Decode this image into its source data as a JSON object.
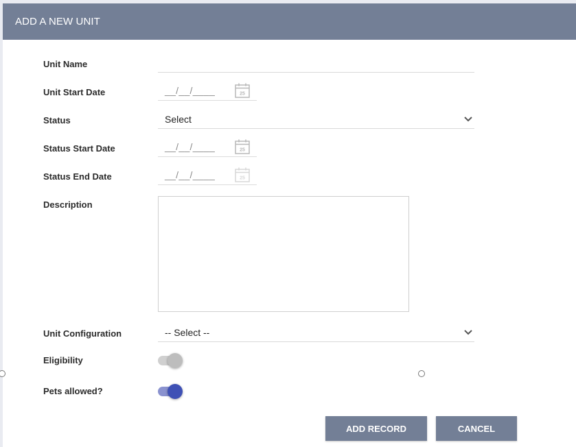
{
  "dialog": {
    "title": "ADD A NEW UNIT"
  },
  "fields": {
    "unit_name": {
      "label": "Unit Name",
      "value": ""
    },
    "unit_start_date": {
      "label": "Unit Start Date",
      "mask": "__/__/____",
      "icon": "calendar-icon"
    },
    "status": {
      "label": "Status",
      "value": "Select",
      "icon": "chevron-down-icon"
    },
    "status_start_date": {
      "label": "Status Start Date",
      "mask": "__/__/____",
      "icon": "calendar-icon"
    },
    "status_end_date": {
      "label": "Status End Date",
      "mask": "__/__/____",
      "icon": "calendar-icon"
    },
    "description": {
      "label": "Description",
      "value": ""
    },
    "unit_configuration": {
      "label": "Unit Configuration",
      "value": "-- Select --",
      "icon": "chevron-down-icon"
    },
    "eligibility": {
      "label": "Eligibility",
      "checked": false
    },
    "pets_allowed": {
      "label": "Pets allowed?",
      "checked": true
    }
  },
  "actions": {
    "add_record": "ADD RECORD",
    "cancel": "CANCEL"
  },
  "colors": {
    "header": "#737f96",
    "button": "#737f96",
    "toggle_on": "#3f51b5",
    "toggle_off": "#bdbdbd"
  }
}
